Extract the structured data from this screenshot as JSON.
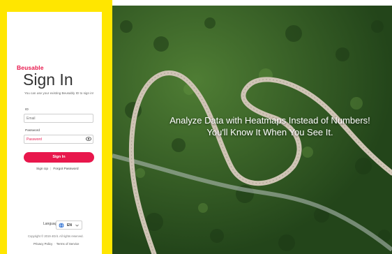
{
  "brand": {
    "logo_text": "Beusable",
    "accent": "#e8174c",
    "frame_color": "#ffe600"
  },
  "signin": {
    "title": "Sign In",
    "helper": "You can use your existing Beusably ID to sign in!",
    "id_label": "ID",
    "id_placeholder": "Email",
    "password_label": "Password",
    "password_placeholder": "Password",
    "submit_label": "Sign In",
    "signup_link": "Sign Up",
    "forgot_link": "Forgot Password"
  },
  "footer": {
    "language_label": "Language",
    "language_code": "EN",
    "copyright": "Copyright © 2019 4Grit. All rights reserved.",
    "privacy_link": "Privacy Policy",
    "terms_link": "Terms of Service"
  },
  "hero": {
    "line1": "Analyze Data with Heatmaps Instead of Numbers!",
    "line2": "You'll Know It When You See It."
  },
  "icons": [
    "eye-icon",
    "globe-icon",
    "chevron-down-icon"
  ]
}
